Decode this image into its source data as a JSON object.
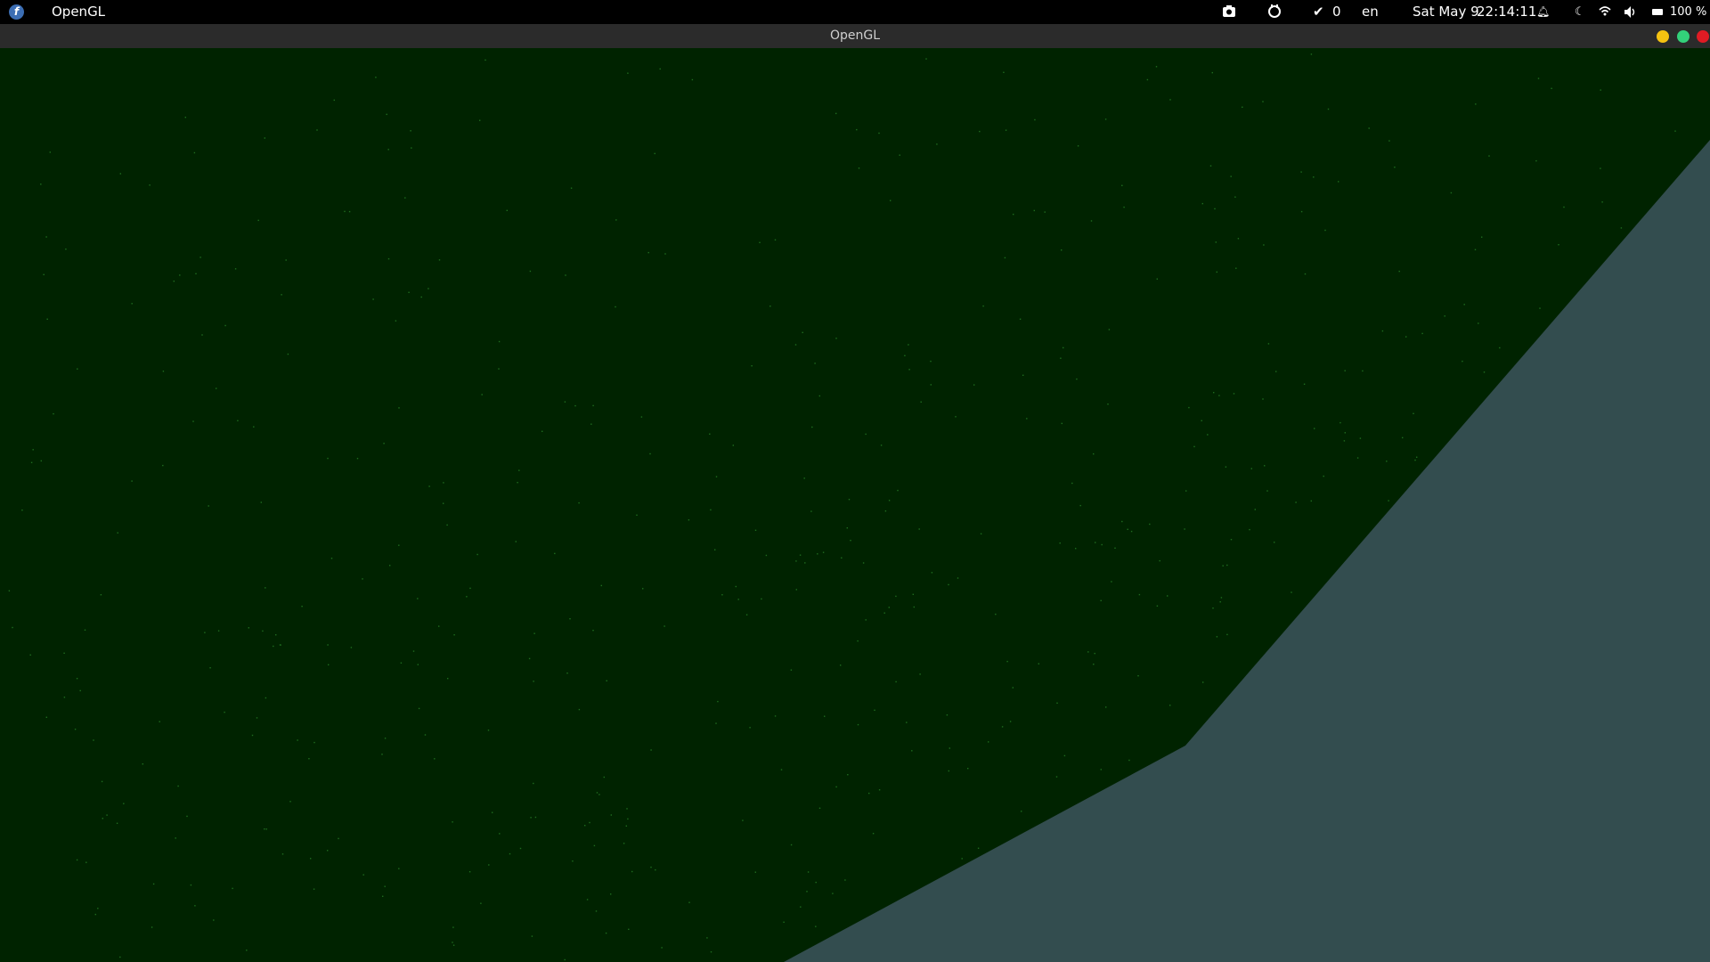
{
  "topbar": {
    "logo_icon": "fedora-logo",
    "logo_glyph": "f",
    "app_name": "OpenGL",
    "screenshot_icon": "camera-icon",
    "extension_icon": "extension-icon",
    "check_count": "0",
    "keyboard_lang": "en",
    "date": "Sat May 9",
    "time": "22:14:11",
    "battery": "100 %"
  },
  "window": {
    "title": "OpenGL"
  },
  "colors": {
    "canvas_bg": "#002300",
    "shape_fill": "#334d4f",
    "star": "#1f6b1f"
  }
}
